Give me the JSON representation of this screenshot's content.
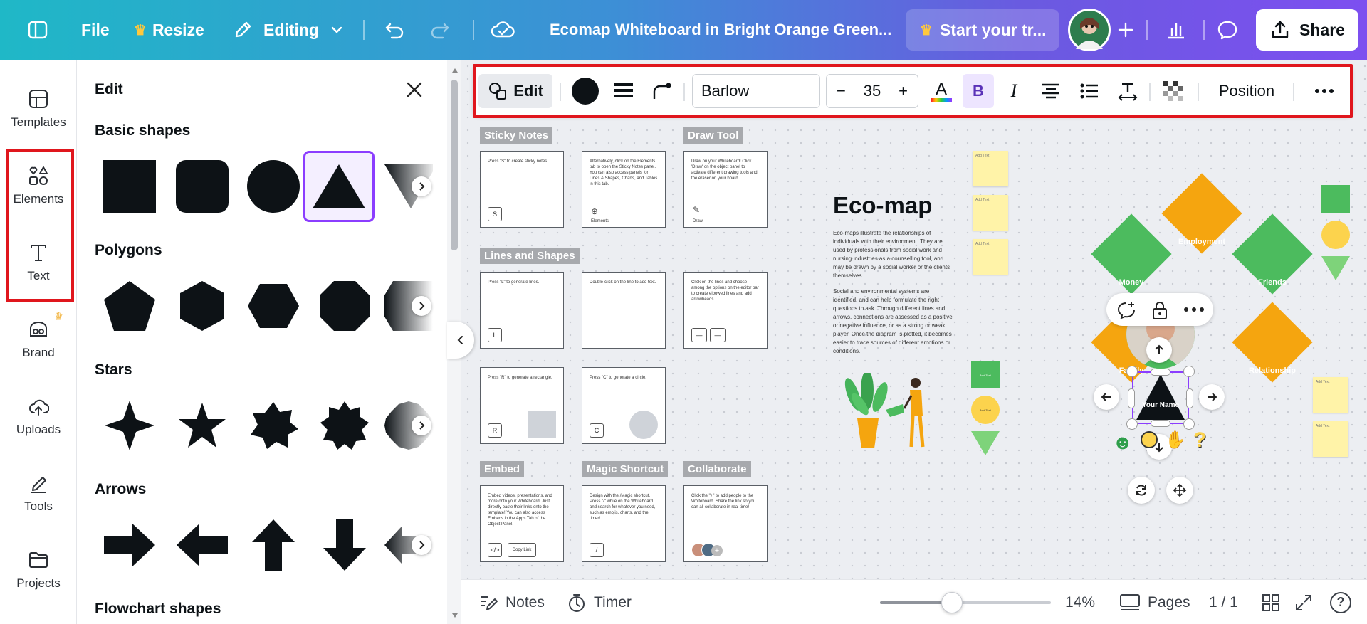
{
  "topbar": {
    "file": "File",
    "resize": "Resize",
    "editing": "Editing",
    "title": "Ecomap Whiteboard in Bright Orange Green...",
    "trial": "Start your tr...",
    "share": "Share",
    "gradient_start": "#1fb8c7",
    "gradient_end": "#7d4ff0"
  },
  "rail": {
    "items": [
      {
        "label": "Templates",
        "icon": "templates-icon"
      },
      {
        "label": "Elements",
        "icon": "elements-icon"
      },
      {
        "label": "Text",
        "icon": "text-icon"
      },
      {
        "label": "Brand",
        "icon": "brand-icon"
      },
      {
        "label": "Uploads",
        "icon": "uploads-icon"
      },
      {
        "label": "Tools",
        "icon": "tools-icon"
      },
      {
        "label": "Projects",
        "icon": "projects-icon"
      }
    ]
  },
  "panel": {
    "title": "Edit",
    "sections": [
      "Basic shapes",
      "Polygons",
      "Stars",
      "Arrows",
      "Flowchart shapes"
    ]
  },
  "toolbar": {
    "edit": "Edit",
    "font": "Barlow",
    "font_size": "35",
    "position": "Position"
  },
  "canvas": {
    "tags": [
      "Sticky Notes",
      "Draw Tool",
      "Lines and Shapes",
      "Embed",
      "Magic Shortcut",
      "Collaborate"
    ],
    "cards": {
      "sticky1": "Press \"S\" to create sticky notes.",
      "sticky2": "Alternatively, click on the Elements tab to open the Sticky Notes panel. You can also access panels for Lines & Shapes, Charts, and Tables in this tab.",
      "sticky2_caption": "Elements",
      "draw": "Draw on your Whiteboard! Click 'Draw' on the object panel to activate different drawing tools and the eraser on your board.",
      "draw_caption": "Draw",
      "lines1": "Press \"L\" to generate lines.",
      "lines2": "Double-click on the line to add text.",
      "lines3": "Click on the lines and choose among the options on the editor bar to create elbowed lines and add arrowheads.",
      "rect": "Press \"R\" to generate a rectangle.",
      "circle": "Press \"C\" to generate a circle.",
      "embed": "Embed videos, presentations, and more onto your Whiteboard. Just directly paste their links onto the template! You can also access Embeds in the Apps Tab of the Object Panel.",
      "embed_button": "Copy Link",
      "magic": "Design with the /Magic shortcut. Press \"/\" while on the Whiteboard and search for whatever you need, such as emojis, charts, and the timer!",
      "collab": "Click the \"+\" to add people to the Whiteboard. Share the link so you can all collaborate in real time!",
      "keys": [
        "S",
        "L",
        "R",
        "C",
        "/",
        "</>"
      ]
    },
    "ecomap": {
      "title": "Eco-map",
      "para1": "Eco-maps illustrate the relationships of individuals with their environment. They are used by professionals from social work and nursing industries as a counselling tool, and may be drawn by a social worker or the clients themselves.",
      "para2": "Social and environmental systems are identified, and can help formulate the right questions to ask. Through different lines and arrows, connections are assessed as a positive or negative influence, or as a strong or weak player. Once the diagram is plotted, it becomes easier to trace sources of different emotions or conditions.",
      "nodes": [
        "Employment",
        "Money",
        "Friends",
        "Family",
        "Relationship"
      ],
      "center": "Your Name",
      "sticky_text": "Add Text",
      "orange": "#f5a50f",
      "green": "#4cbb5e"
    }
  },
  "bottombar": {
    "notes": "Notes",
    "timer": "Timer",
    "zoom": "14%",
    "pages": "Pages",
    "page_count": "1 / 1"
  },
  "zoom_level": 0.14
}
